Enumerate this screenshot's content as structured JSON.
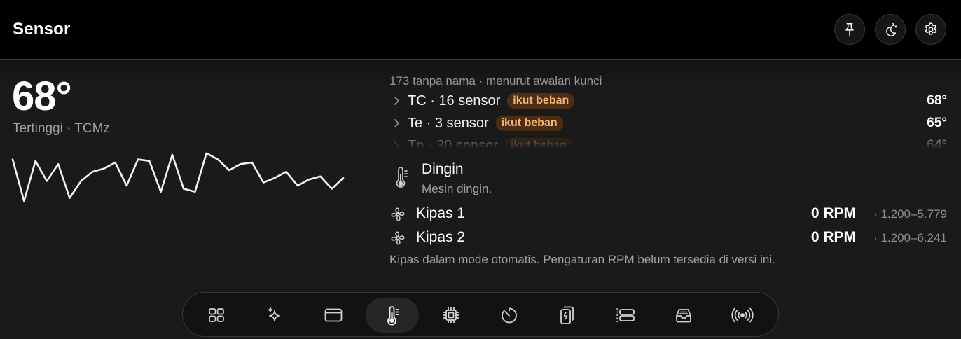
{
  "header": {
    "title": "Sensor"
  },
  "header_buttons": [
    "pin-icon",
    "moon-sleep-icon",
    "gear-icon"
  ],
  "summary": {
    "temperature": "68°",
    "subtitle": "Tertinggi · TCMz"
  },
  "sparkline": {
    "values": [
      52,
      25,
      51,
      38,
      49,
      27,
      38,
      44,
      46,
      50,
      35,
      52,
      51,
      31,
      55,
      33,
      31,
      56,
      52,
      45,
      49,
      50,
      37,
      40,
      44,
      35,
      39,
      41,
      33,
      40
    ]
  },
  "sensor_groups": {
    "header": "173 tanpa nama · menurut awalan kunci",
    "items": [
      {
        "name": "TC · 16 sensor",
        "badge": "ikut beban",
        "value": "68°"
      },
      {
        "name": "Te · 3 sensor",
        "badge": "ikut beban",
        "value": "65°"
      },
      {
        "name": "Tp · 30 sensor",
        "badge": "ikut beban",
        "value": "64°"
      }
    ]
  },
  "status": {
    "title": "Dingin",
    "subtitle": "Mesin dingin.",
    "icon": "thermometer-icon"
  },
  "fans": [
    {
      "name": "Kipas 1",
      "rpm": "0 RPM",
      "range": "· 1.200–5.779"
    },
    {
      "name": "Kipas 2",
      "rpm": "0 RPM",
      "range": "· 1.200–6.241"
    }
  ],
  "fan_note": "Kipas dalam mode otomatis. Pengaturan RPM belum tersedia di versi ini.",
  "dock": {
    "items": [
      "grid-icon",
      "sparkles-icon",
      "window-icon",
      "thermometer-icon",
      "chip-icon",
      "gauge-icon",
      "battery-icon",
      "storage-icon",
      "tray-icon",
      "wireless-icon"
    ],
    "active": "thermometer-icon"
  },
  "colors": {
    "badge_text": "#ffb46e",
    "badge_bg": "#4a2e16",
    "background": "#1a1a1b"
  }
}
